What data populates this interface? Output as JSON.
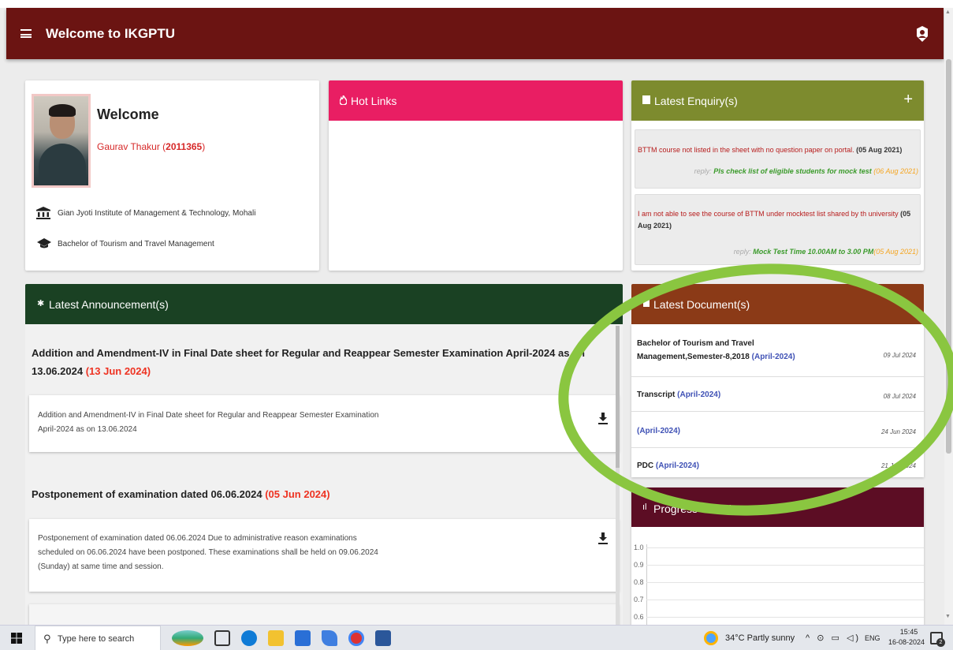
{
  "appbar": {
    "title": "Welcome to IKGPTU"
  },
  "profile": {
    "heading": "Welcome",
    "student_name": "Gaurav Thakur",
    "student_id": "2011365",
    "institute": "Gian Jyoti Institute of Management & Technology, Mohali",
    "program": "Bachelor of Tourism and Travel Management"
  },
  "hotlinks": {
    "title": "Hot Links"
  },
  "enquiry": {
    "title": "Latest Enquiry(s)",
    "items": [
      {
        "question": "BTTM course not listed in the sheet with no question paper on portal.",
        "question_date": "(05 Aug 2021)",
        "reply_label": "reply:",
        "reply": "Pls check list of eligible students for mock test",
        "reply_date": "(06 Aug 2021)"
      },
      {
        "question": "I am not able to see the course of BTTM under mocktest list shared by th university",
        "question_date": "(05 Aug 2021)",
        "reply_label": "reply:",
        "reply": "Mock Test Time 10.00AM to 3.00 PM",
        "reply_date": "(05 Aug 2021)"
      }
    ]
  },
  "announcements": {
    "title": "Latest Announcement(s)",
    "items": [
      {
        "title_part1": "Addition and Amendment-IV in Final Date sheet for Regular and Reappear Semester Examination April-2024 as on 13.06.2024",
        "date": "(13 Jun 2024)",
        "body_line1": "Addition and Amendment-IV in Final Date sheet for Regular and Reappear Semester Examination",
        "body_line2": "April-2024 as on 13.06.2024"
      },
      {
        "title_part1": "Postponement of examination dated 06.06.2024",
        "date": "(05 Jun 2024)",
        "body_line1": "Postponement of examination dated 06.06.2024 Due to administrative reason examinations",
        "body_line2": "scheduled on 06.06.2024 have been postponed. These examinations shall be held on 09.06.2024",
        "body_line3": "(Sunday) at same time and session."
      }
    ]
  },
  "documents": {
    "title": "Latest Document(s)",
    "items": [
      {
        "name_line1": "Bachelor of Tourism and Travel",
        "name_line2": "Management,Semester-8,2018",
        "session": "(April-2024)",
        "date": "09 Jul 2024"
      },
      {
        "name": "Transcript",
        "session": "(April-2024)",
        "date": "08 Jul 2024"
      },
      {
        "name": "",
        "session": "(April-2024)",
        "date": "24 Jun 2024"
      },
      {
        "name": "PDC",
        "session": "(April-2024)",
        "date": "21 Jun 2024"
      }
    ]
  },
  "progress": {
    "title": "Progress Calculator",
    "y_ticks": [
      "1.0",
      "0.9",
      "0.8",
      "0.7",
      "0.6"
    ]
  },
  "taskbar": {
    "search_placeholder": "Type here to search",
    "weather": "34°C  Partly sunny",
    "lang": "ENG",
    "time": "15:45",
    "date": "16-08-2024",
    "notif_count": "2"
  },
  "colors": {
    "appbar": "#6b1412",
    "hotlinks": "#e91e63",
    "enquiry": "#7d8b2e",
    "announcements": "#1a4123",
    "documents": "#8b3a17",
    "progress": "#5c0d24",
    "highlight": "#8ac640"
  }
}
